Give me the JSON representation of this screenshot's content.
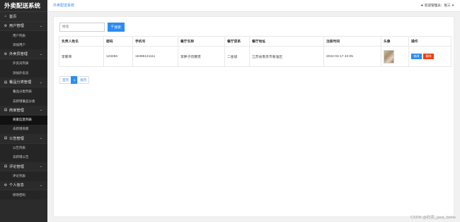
{
  "app": {
    "title": "外卖配送系统"
  },
  "topbar": {
    "breadcrumb": "外卖配送系统",
    "user_text": "欢迎管理员：张三",
    "caret": "▾"
  },
  "sidebar": {
    "items": [
      {
        "label": "首页",
        "icon": "home-icon",
        "glyph": "⌂",
        "chev": ""
      },
      {
        "label": "用户管理",
        "icon": "user-icon",
        "glyph": "⚙",
        "chev": "⌄"
      },
      {
        "label": "用户列表",
        "sub": true
      },
      {
        "label": "添加用户",
        "sub": true
      },
      {
        "label": "外卖员管理",
        "icon": "rider-icon",
        "glyph": "⚙",
        "chev": "⌄"
      },
      {
        "label": "外卖员列表",
        "sub": true
      },
      {
        "label": "添加外卖员",
        "sub": true
      },
      {
        "label": "餐品分类管理",
        "icon": "doc-icon",
        "glyph": "▤",
        "chev": "⌄"
      },
      {
        "label": "餐品分类列表",
        "sub": true
      },
      {
        "label": "去新增餐品分类",
        "sub": true
      },
      {
        "label": "商家管理",
        "icon": "doc-icon",
        "glyph": "▤",
        "chev": "⌄"
      },
      {
        "label": "商家信息列表",
        "sub": true,
        "active": true
      },
      {
        "label": "去新增商家",
        "sub": true
      },
      {
        "label": "公告管理",
        "icon": "doc-icon",
        "glyph": "▤",
        "chev": "⌄"
      },
      {
        "label": "公告列表",
        "sub": true
      },
      {
        "label": "去新增公告",
        "sub": true
      },
      {
        "label": "评论管理",
        "icon": "doc-icon",
        "glyph": "▤",
        "chev": "⌄"
      },
      {
        "label": "评论列表",
        "sub": true
      },
      {
        "label": "个人信息",
        "icon": "gear-icon",
        "glyph": "⚙",
        "chev": "⌄"
      },
      {
        "label": "修改密码",
        "sub": true
      }
    ]
  },
  "search": {
    "placeholder": "姓名",
    "button_label": "搜索",
    "button_icon": "search-icon"
  },
  "table": {
    "headers": [
      "负责人姓名",
      "密码",
      "手机号",
      "餐厅名称",
      "餐厅菜系",
      "餐厅地址",
      "注册时间",
      "头像",
      "操作"
    ],
    "rows": [
      {
        "name": "李繁荣",
        "password": "123456",
        "phone": "15365121111",
        "restaurant": "李胖子肉蟹煲",
        "cuisine": "二星级",
        "address": "江苏省南京市秦淮区",
        "time": "2022-03-17 22:05",
        "edit": "修改",
        "delete": "删除"
      }
    ]
  },
  "pager": {
    "first": "首页",
    "current": "1",
    "last": "尾页"
  },
  "watermark": "CSDN @码农_java_bishe"
}
